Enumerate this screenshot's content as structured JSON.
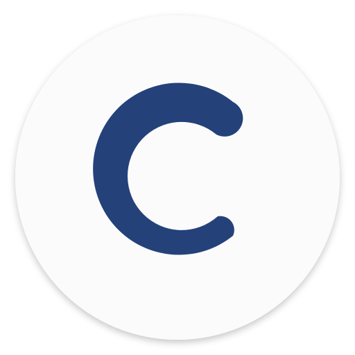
{
  "icon": {
    "name": "letter-c-logo",
    "background_color": "#fbfbfb",
    "glyph_color": "#24417a",
    "shadow_color": "#d9d9d9"
  }
}
